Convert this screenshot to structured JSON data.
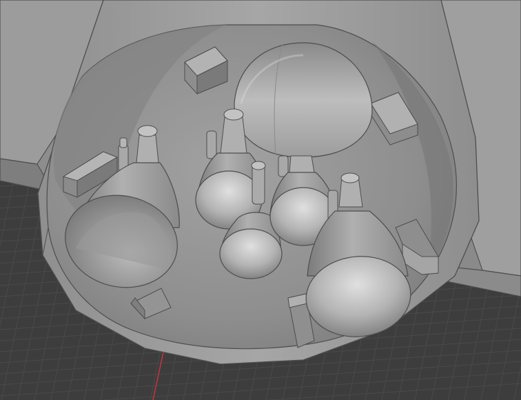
{
  "viewport": {
    "kind": "3d-viewport-render",
    "background_color": "#3d3d3d",
    "grid_color": "#4a4a4a",
    "x_axis_color": "#c9343f"
  },
  "model": {
    "base_color": "#9a9a9a",
    "shade_color": "#6f6f6f",
    "highlight_color": "#d4d4d4",
    "edge_color": "#4d4d4d",
    "engine_nozzle_count": 6,
    "bracket_count": 6
  }
}
